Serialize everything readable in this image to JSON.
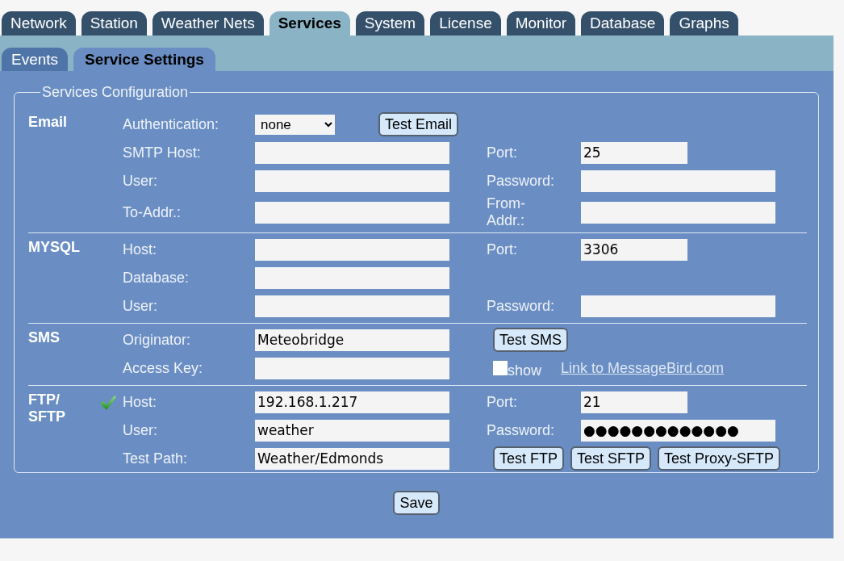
{
  "tabs": [
    {
      "label": "Network",
      "selected": false
    },
    {
      "label": "Station",
      "selected": false
    },
    {
      "label": "Weather Nets",
      "selected": false
    },
    {
      "label": "Services",
      "selected": true
    },
    {
      "label": "System",
      "selected": false
    },
    {
      "label": "License",
      "selected": false
    },
    {
      "label": "Monitor",
      "selected": false
    },
    {
      "label": "Database",
      "selected": false
    },
    {
      "label": "Graphs",
      "selected": false
    }
  ],
  "subtabs": [
    {
      "label": "Events",
      "selected": false
    },
    {
      "label": "Service Settings",
      "selected": true
    }
  ],
  "config": {
    "legend": "Services Configuration",
    "sections": [
      {
        "title": "Email",
        "ok": false,
        "rows": [
          {
            "left": {
              "kind": "select",
              "label": "Authentication:",
              "value": "none"
            },
            "right": {
              "kind": "buttons",
              "buttons": [
                "Test Email"
              ]
            }
          },
          {
            "left": {
              "kind": "field",
              "label": "SMTP Host:"
            },
            "right": {
              "kind": "short-field",
              "label": "Port:",
              "value": "25"
            }
          },
          {
            "left": {
              "kind": "field",
              "label": "User:"
            },
            "right": {
              "kind": "field",
              "label": "Password:"
            }
          },
          {
            "left": {
              "kind": "field",
              "label": "To-Addr.:"
            },
            "right": {
              "kind": "field",
              "label": "From-Addr.:"
            }
          }
        ]
      },
      {
        "title": "MYSQL",
        "ok": false,
        "rows": [
          {
            "left": {
              "kind": "field",
              "label": "Host:"
            },
            "right": {
              "kind": "short-field",
              "label": "Port:",
              "value": "3306"
            }
          },
          {
            "left": {
              "kind": "field",
              "label": "Database:"
            }
          },
          {
            "left": {
              "kind": "field",
              "label": "User:"
            },
            "right": {
              "kind": "field",
              "label": "Password:"
            }
          }
        ]
      },
      {
        "title": "SMS",
        "ok": false,
        "rows": [
          {
            "left": {
              "kind": "field",
              "label": "Originator:",
              "value": "Meteobridge"
            },
            "right": {
              "kind": "buttons",
              "buttons": [
                "Test SMS"
              ]
            }
          },
          {
            "left": {
              "kind": "field",
              "label": "Access Key:"
            },
            "right": {
              "kind": "checkbox-link",
              "label": "show",
              "checked": false,
              "link": "Link to MessageBird.com"
            }
          }
        ]
      },
      {
        "title": "FTP/ SFTP",
        "ok": true,
        "rows": [
          {
            "left": {
              "kind": "field",
              "label": "Host:",
              "value": "192.168.1.217"
            },
            "right": {
              "kind": "short-field",
              "label": "Port:",
              "value": "21"
            }
          },
          {
            "left": {
              "kind": "field",
              "label": "User:",
              "value": "weather"
            },
            "right": {
              "kind": "field",
              "label": "Password:",
              "value": "●●●●●●●●●●●●●"
            }
          },
          {
            "left": {
              "kind": "field",
              "label": "Test Path:",
              "value": "Weather/Edmonds"
            },
            "right": {
              "kind": "buttons",
              "buttons": [
                "Test FTP",
                "Test SFTP",
                "Test Proxy-SFTP"
              ]
            }
          }
        ]
      }
    ]
  },
  "save_button": "Save"
}
